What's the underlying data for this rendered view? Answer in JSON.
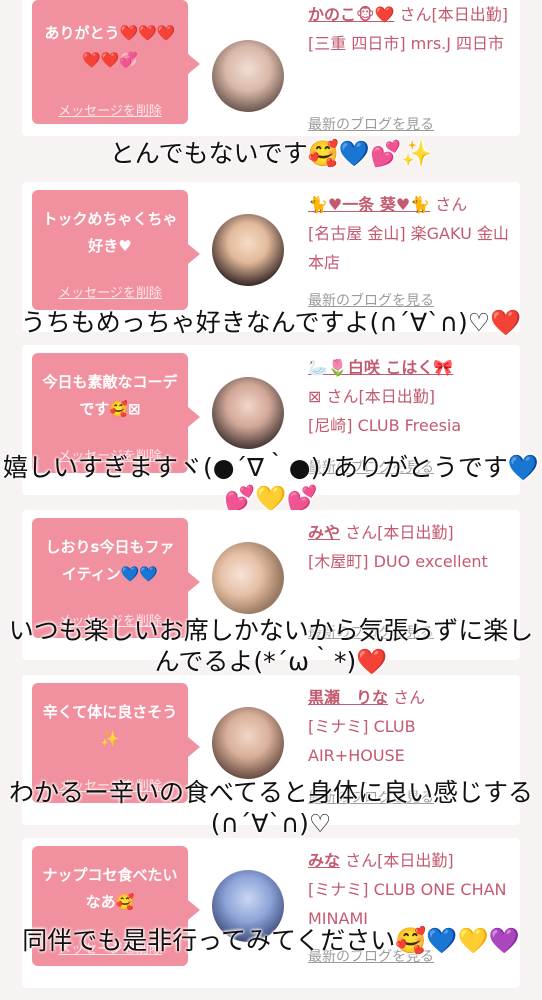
{
  "cards": [
    {
      "bubble": "ありがとう❤️❤️❤️❤️❤️💞",
      "delete_label": "メッセージを削除",
      "name": "かのこ🐵❤️",
      "suffix": "さん[本日出勤]",
      "shop": "[三重 四日市] mrs.J 四日市",
      "blog_label": "最新のブログを見る",
      "comment": "とんでもないです🥰💙💕✨"
    },
    {
      "bubble": "トックめちゃくちゃ好き♥",
      "delete_label": "メッセージを削除",
      "name": "🐈♥一条 葵♥🐈",
      "suffix": "さん",
      "shop": "[名古屋 金山] 楽GAKU 金山本店",
      "blog_label": "最新のブログを見る",
      "comment": "うちもめっちゃ好きなんですよ(∩´∀`∩)♡❤️"
    },
    {
      "bubble": "今日も素敵なコーデです🥰⊠",
      "delete_label": "メッセージを削除",
      "name": "🦢🌷白咲 こはく🎀",
      "suffix": "⊠ さん[本日出勤]",
      "shop": "[尼崎] CLUB Freesia",
      "blog_label": "最新のブログを見る",
      "comment": "嬉しいすぎますヾ(●´∇｀●)ﾉありがとうです💙💕💛💕"
    },
    {
      "bubble": "しおりs今日もファイティン💙💙",
      "delete_label": "メッセージを削除",
      "name": "みや",
      "suffix": "さん[本日出勤]",
      "shop": "[木屋町] DUO excellent",
      "blog_label": "最新のブログを見る",
      "comment": "いつも楽しいお席しかないから気張らずに楽しんでるよ(*´ω｀*)❤️"
    },
    {
      "bubble": "辛くて体に良さそう✨",
      "delete_label": "メッセージを削除",
      "name": "黒瀬　りな",
      "suffix": "さん",
      "shop": "[ミナミ] CLUB AIR+HOUSE",
      "blog_label": "最新のブログを見る",
      "comment": "わかるー辛いの食べてると身体に良い感じする(∩´∀`∩)♡"
    },
    {
      "bubble": "ナップコセ食べたいなあ🥰",
      "delete_label": "メッセージを削除",
      "name": "みな",
      "suffix": "さん[本日出勤]",
      "shop": "[ミナミ] CLUB ONE CHAN MINAMI",
      "blog_label": "最新のブログを見る",
      "comment": "同伴でも是非行ってみてください🥰💙💛💜"
    }
  ],
  "colors": {
    "bubble": "#f1919f",
    "name": "#c45a6f",
    "background": "#f7f3f3"
  }
}
